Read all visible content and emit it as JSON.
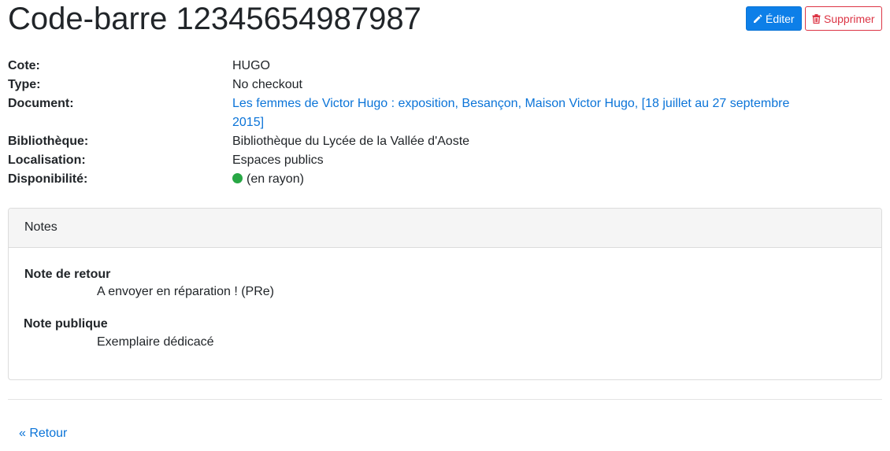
{
  "page": {
    "title": "Code-barre 12345654987987"
  },
  "actions": {
    "edit_label": "Éditer",
    "delete_label": "Supprimer"
  },
  "details": {
    "cote_label": "Cote:",
    "cote_value": "HUGO",
    "type_label": "Type:",
    "type_value": "No checkout",
    "document_label": "Document:",
    "document_value": "Les femmes de Victor Hugo : exposition, Besançon, Maison Victor Hugo, [18 juillet au 27 septembre 2015]",
    "library_label": "Bibliothèque:",
    "library_value": "Bibliothèque du Lycée de la Vallée d'Aoste",
    "location_label": "Localisation:",
    "location_value": "Espaces publics",
    "availability_label": "Disponibilité:",
    "availability_value": "(en rayon)",
    "availability_color": "#28a745"
  },
  "notes": {
    "header": "Notes",
    "return_note_label": "Note de retour",
    "return_note_value": "A envoyer en réparation ! (PRe)",
    "public_note_label": "Note publique",
    "public_note_value": "Exemplaire dédicacé"
  },
  "footer": {
    "back_label": "« Retour"
  },
  "colors": {
    "primary": "#0d7fe8",
    "danger": "#dc3545",
    "link": "#0b74d8"
  }
}
